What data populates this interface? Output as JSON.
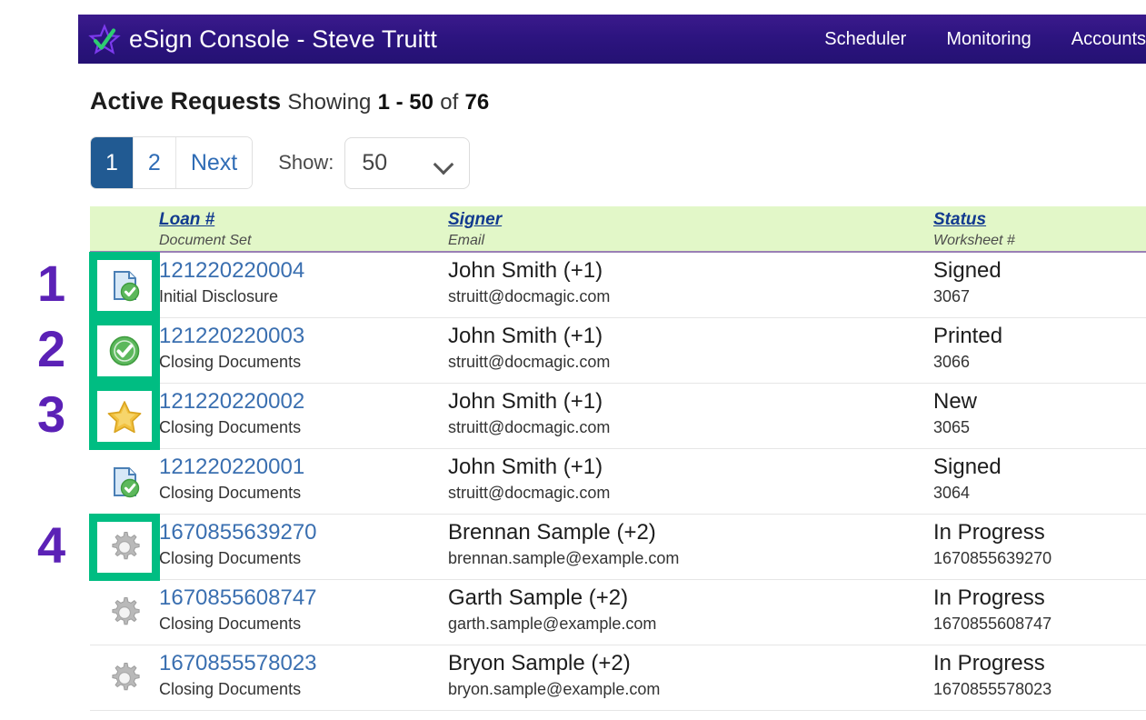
{
  "header": {
    "brand_title": "eSign Console - Steve Truitt",
    "logo_icon": "star-check-logo-icon",
    "nav": [
      {
        "label": "Scheduler",
        "name": "nav-scheduler"
      },
      {
        "label": "Monitoring",
        "name": "nav-monitoring"
      },
      {
        "label": "Accounts",
        "name": "nav-accounts"
      }
    ],
    "colors": {
      "bar_start": "#3b1a8c",
      "bar_end": "#241173"
    }
  },
  "page": {
    "title": "Active Requests",
    "showing_label": "Showing",
    "showing_range": "1 - 50",
    "of_label": "of",
    "total": "76"
  },
  "pagination": {
    "pages": [
      {
        "label": "1",
        "active": true
      },
      {
        "label": "2",
        "active": false
      },
      {
        "label": "Next",
        "active": false
      }
    ],
    "show_label": "Show:",
    "page_size": "50",
    "chevron_icon": "chevron-down-icon",
    "active_color": "#215a92"
  },
  "table": {
    "header_bg": "#e2f7c8",
    "columns": [
      {
        "main": "",
        "sub": "",
        "name": "col-status-icon"
      },
      {
        "main": "Loan #",
        "sub": "Document Set",
        "name": "col-loan"
      },
      {
        "main": "Signer",
        "sub": "Email",
        "name": "col-signer"
      },
      {
        "main": "Status",
        "sub": "Worksheet #",
        "name": "col-status"
      }
    ],
    "rows": [
      {
        "icon": "document-check-icon",
        "loan": "121220220004",
        "document_set": "Initial Disclosure",
        "signer": "John Smith (+1)",
        "email": "struitt@docmagic.com",
        "status": "Signed",
        "worksheet": "3067"
      },
      {
        "icon": "green-check-circle-icon",
        "loan": "121220220003",
        "document_set": "Closing Documents",
        "signer": "John Smith (+1)",
        "email": "struitt@docmagic.com",
        "status": "Printed",
        "worksheet": "3066"
      },
      {
        "icon": "gold-star-icon",
        "loan": "121220220002",
        "document_set": "Closing Documents",
        "signer": "John Smith (+1)",
        "email": "struitt@docmagic.com",
        "status": "New",
        "worksheet": "3065"
      },
      {
        "icon": "document-check-icon",
        "loan": "121220220001",
        "document_set": "Closing Documents",
        "signer": "John Smith (+1)",
        "email": "struitt@docmagic.com",
        "status": "Signed",
        "worksheet": "3064"
      },
      {
        "icon": "gear-icon",
        "loan": "1670855639270",
        "document_set": "Closing Documents",
        "signer": "Brennan Sample (+2)",
        "email": "brennan.sample@example.com",
        "status": "In Progress",
        "worksheet": "1670855639270"
      },
      {
        "icon": "gear-icon",
        "loan": "1670855608747",
        "document_set": "Closing Documents",
        "signer": "Garth Sample (+2)",
        "email": "garth.sample@example.com",
        "status": "In Progress",
        "worksheet": "1670855608747"
      },
      {
        "icon": "gear-icon",
        "loan": "1670855578023",
        "document_set": "Closing Documents",
        "signer": "Bryon Sample (+2)",
        "email": "bryon.sample@example.com",
        "status": "In Progress",
        "worksheet": "1670855578023"
      }
    ]
  },
  "annotations": {
    "highlight_color": "#00bd82",
    "number_color": "#5b21b6",
    "markers": [
      {
        "label": "1",
        "target_row": 0
      },
      {
        "label": "2",
        "target_row": 1
      },
      {
        "label": "3",
        "target_row": 2
      },
      {
        "label": "4",
        "target_row": 4
      }
    ]
  }
}
